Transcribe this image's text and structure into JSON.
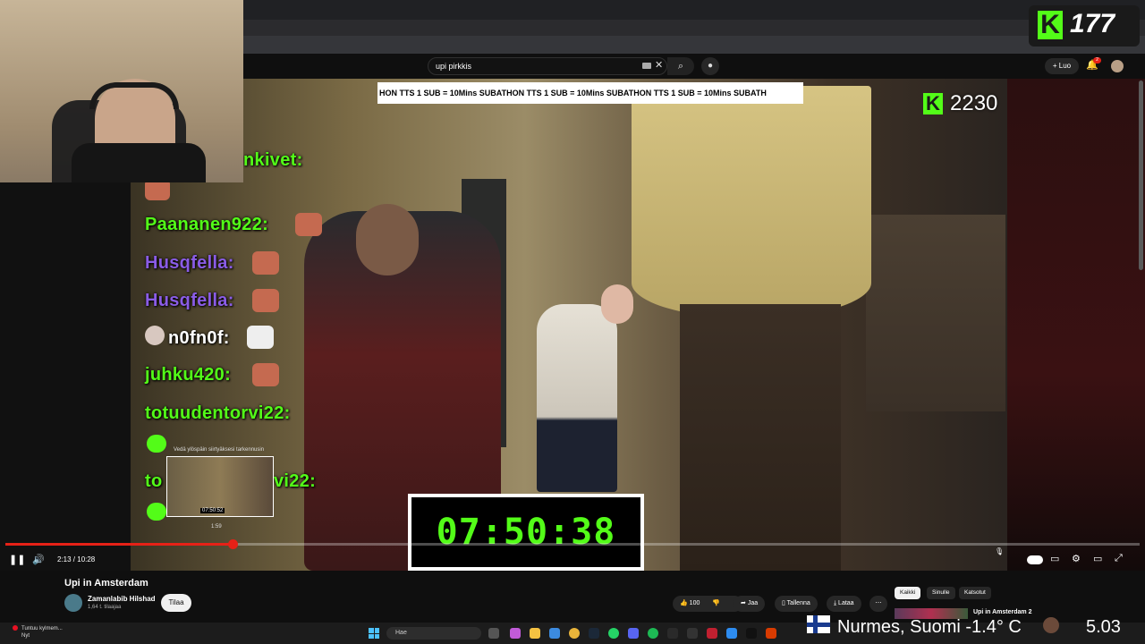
{
  "browser": {
    "window_controls": [
      "—",
      "□",
      "✕"
    ]
  },
  "youtube": {
    "search": {
      "value": "upi pirkkis",
      "clear": "✕",
      "search_icon": "⌕",
      "mic_icon": "🎤"
    },
    "create_label": "+ Luo",
    "notifications_count": "2"
  },
  "overlay": {
    "kick_top_count": "177",
    "kick_video_count": "2230",
    "ticker": "HON TTS 1 SUB = 10Mins  SUBATHON TTS 1 SUB = 10Mins  SUBATHON TTS 1 SUB = 10Mins  SUBATH",
    "timer": "07:50:38"
  },
  "chat": [
    {
      "user": "Paananen922:",
      "color": "#53fc18"
    },
    {
      "user": "Husqfella:",
      "color": "#8a5ce6"
    },
    {
      "user": "Husqfella:",
      "color": "#8a5ce6"
    },
    {
      "user": "n0fn0f:",
      "color": "#ffffff"
    },
    {
      "user": "juhku420:",
      "color": "#53fc18"
    },
    {
      "user": "totuudentorvi22:",
      "color": "#53fc18"
    },
    {
      "user": "to",
      "color": "#53fc18"
    },
    {
      "user": "vi22:",
      "color": "#53fc18"
    },
    {
      "user": "nkivet:",
      "color": "#53fc18"
    }
  ],
  "player": {
    "preview_hint": "Vedä ylöspäin siirtyäksesi tarkennusin",
    "preview_time": "07:50:52",
    "hover_time": "1:59",
    "time": "2:13 / 10:28",
    "progress": 0.2
  },
  "video": {
    "title": "Upi in Amsterdam",
    "channel": "Zamanlabib Hilshad",
    "subscribers": "1,64 t. tilaajaa",
    "subscribe": "Tilaa",
    "likes": "100",
    "share": "Jaa",
    "save": "Tallenna",
    "download": "Lataa",
    "more": "⋯"
  },
  "chips": [
    "Kaikki",
    "Sinulle",
    "Katsotut"
  ],
  "up_next": {
    "title": "Upi in Amsterdam 2"
  },
  "taskbar": {
    "notification": "Tuntuu kylmem...",
    "notification_sub": "Nyt",
    "search_placeholder": "Hae",
    "weather": "Nurmes, Suomi  -1.4° C",
    "clock": "5.03"
  }
}
